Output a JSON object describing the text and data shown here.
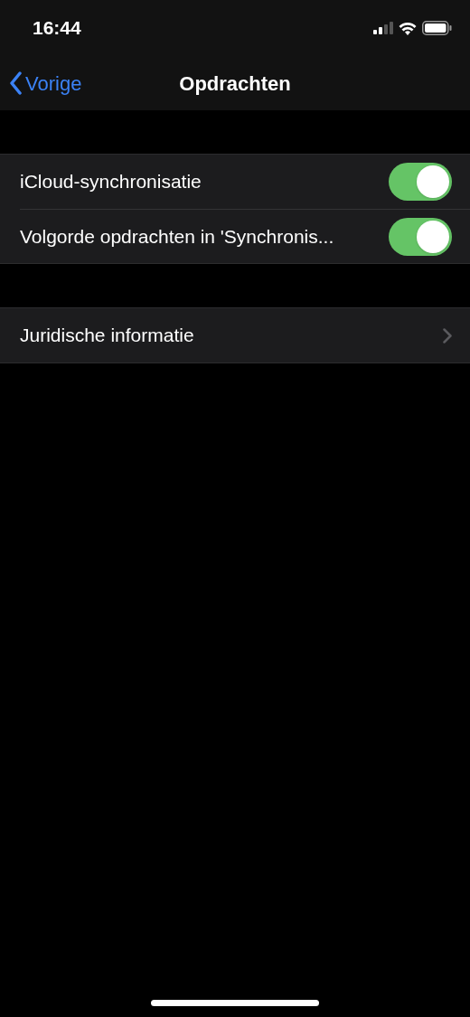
{
  "status_bar": {
    "time": "16:44"
  },
  "nav": {
    "back": "Vorige",
    "title": "Opdrachten"
  },
  "groups": [
    {
      "rows": [
        {
          "kind": "toggle",
          "label": "iCloud-synchronisatie",
          "on": true
        },
        {
          "kind": "toggle",
          "label": "Volgorde opdrachten in 'Synchronis...",
          "on": true
        }
      ]
    },
    {
      "rows": [
        {
          "kind": "link",
          "label": "Juridische informatie"
        }
      ]
    }
  ]
}
